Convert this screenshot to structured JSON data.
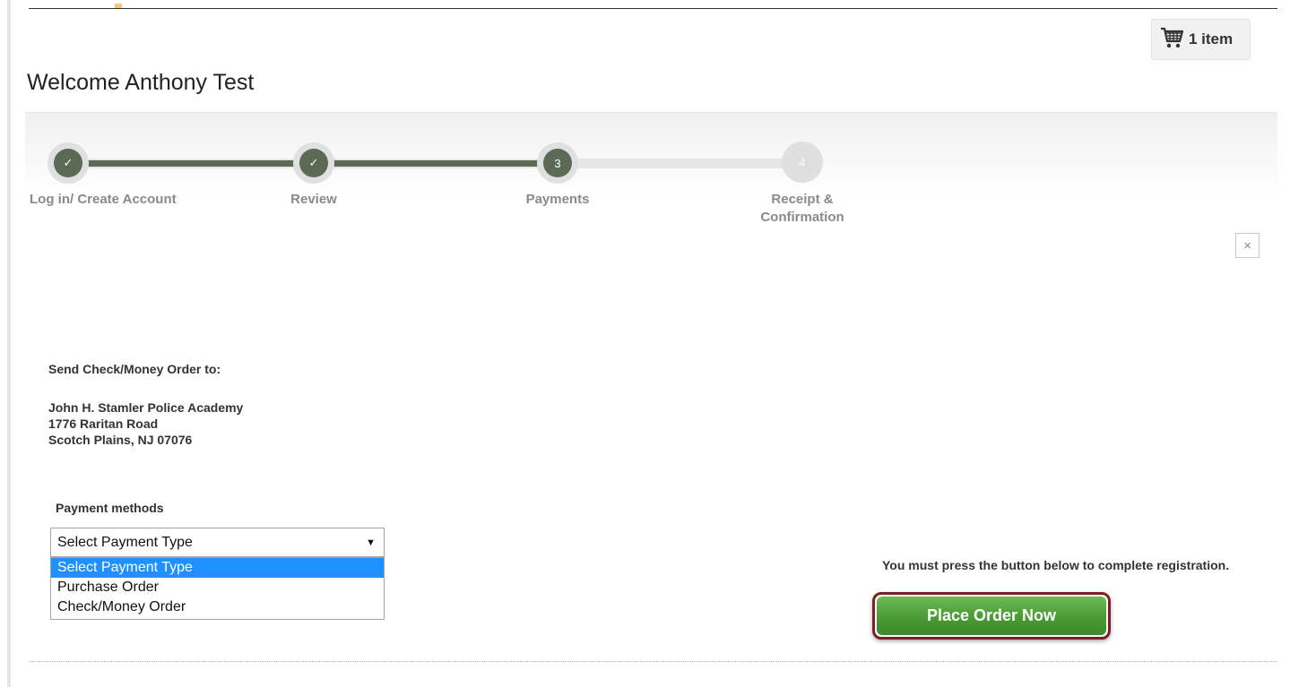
{
  "cart": {
    "label": "1 item",
    "icon": "shopping-cart-icon"
  },
  "welcome": "Welcome Anthony Test",
  "steps": [
    {
      "label": "Log in/ Create Account",
      "marker": "✓",
      "state": "done"
    },
    {
      "label": "Review",
      "marker": "✓",
      "state": "done"
    },
    {
      "label": "Payments",
      "marker": "3",
      "state": "current"
    },
    {
      "label_line1": "Receipt &",
      "label_line2": "Confirmation",
      "marker": "4",
      "state": "future"
    }
  ],
  "close": {
    "glyph": "×"
  },
  "check_info": {
    "heading": "Send Check/Money Order to:",
    "address": [
      "John H. Stamler Police Academy",
      "1776 Raritan Road",
      "Scotch Plains, NJ 07076"
    ]
  },
  "payment": {
    "label": "Payment methods",
    "selected": "Select Payment Type",
    "arrow": "▼",
    "options": [
      "Select Payment Type",
      "Purchase Order",
      "Check/Money Order"
    ],
    "highlighted_index": 0
  },
  "order": {
    "notice": "You must press the button below to complete registration.",
    "button": "Place Order Now"
  },
  "colors": {
    "step_complete": "#5c6a55",
    "button_green": "#4a9a34",
    "button_border": "#7c1f24",
    "highlight": "#1e90ff"
  }
}
